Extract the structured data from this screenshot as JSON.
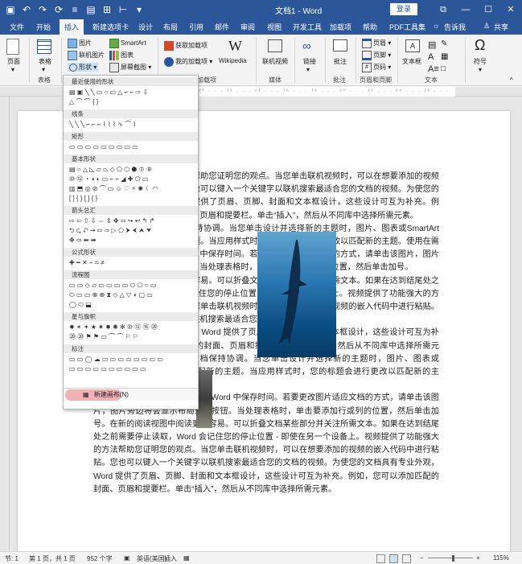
{
  "titlebar": {
    "title": "文档1 - Word",
    "login": "登录",
    "quick_access": [
      "save-icon",
      "undo-icon",
      "redo-icon",
      "repeat-icon",
      "menu-icon",
      "print-preview-icon",
      "layout-icon",
      "format-icon",
      "more-icon"
    ]
  },
  "tabs": [
    "文件",
    "开始",
    "插入",
    "新建选项卡",
    "设计",
    "布局",
    "引用",
    "邮件",
    "审阅",
    "视图",
    "开发工具",
    "加载项",
    "帮助",
    "PDF工具集",
    "告诉我",
    "共享"
  ],
  "ribbon": {
    "page": "页面",
    "table": "表格",
    "picture": "图片",
    "online_picture": "联机图片",
    "shapes": "形状",
    "smartart": "SmartArt",
    "chart": "图表",
    "screenshot": "屏幕截图",
    "get_addins": "获取加载项",
    "my_addins": "我的加载项",
    "wikipedia": "Wikipedia",
    "online_video": "联机视频",
    "link": "链接",
    "comment": "批注",
    "header": "页眉",
    "footer": "页脚",
    "page_number": "页码",
    "textbox": "文本框",
    "symbol": "符号",
    "groups": {
      "table": "表格",
      "addins": "加载项",
      "media": "媒体",
      "comment": "批注",
      "header_footer": "页眉和页脚",
      "text": "文本"
    }
  },
  "shapes_menu": {
    "sections": [
      "最近使用的形状",
      "线条",
      "矩形",
      "基本形状",
      "箭头总汇",
      "公式形状",
      "流程图",
      "星与旗帜",
      "标注"
    ],
    "new_canvas": "新建画布(N)"
  },
  "document": {
    "paragraphs": [
      "视频提供了功能强大的方法帮助您证明您的观点。当您单击联机视频时，可以在想要添加的视频的嵌入代码中进行粘贴。您也可以键入一个关键字以联机搜索最适合您的文档的视频。为使您的文档具有专业外观，Word 提供了页眉、页脚、封面和文本框设计，这些设计可互为补充。例如，您可以添加匹配的封面、页眉和提要栏。单击“插入”，然后从不同库中选择所需元素。",
      "主题和样式也有助于文档保持协调。当您单击设计并选择新的主题时，图片、图表或SmartArt 图形将会更改以匹配新的主题。当应用样式时，您的标题会进行更改以匹配新的主题。使用在需要位置出现的新按钮在 Word 中保存时间。若要更改图片适应文档的方式，请单击该图片，图片旁边将会显示布局选项按钮。当处理表格时，单击要添加行或列的位置，然后单击加号。",
      "在新的阅读视图中阅读更加容易。可以折叠文档某些部分并关注所需文本。如果在达到结尾处之前需要停止读取，Word 会记住您的停止位置 - 即使在另一个设备上。视频提供了功能强大的方法帮助您证明您的观点。当您单击联机视频时，可以在想要添加的视频的嵌入代码中进行粘贴。您也可以键入一个关键字以联机搜索最适合您的文档的视频。",
      "为使您的文档具有专业外观，Word 提供了页眉、页脚、封面和文本框设计，这些设计可互为补充。例如，您可以添加匹配的封面、页眉和提要栏。单击“插入”，然后从不同库中选择所需元素。主题和样式也有助于文档保持协调。当您单击设计并选择新的主题时，图片、图表或 SmartArt 图形将会更改以匹配新的主题。当应用样式时，您的标题会进行更改以匹配新的主题。",
      "使用在需要位置出现的新按钮在 Word 中保存时间。若要更改图片适应文档的方式，请单击该图片，图片旁边将会显示布局选项按钮。当处理表格时，单击要添加行或列的位置，然后单击加号。在新的阅读视图中阅读更加容易。可以折叠文档某些部分并关注所需文本。如果在达到结尾处之前需要停止读取，Word 会记住您的停止位置 - 即使在另一个设备上。视频提供了功能强大的方法帮助您证明您的观点。当您单击联机视频时，可以在想要添加的视频的嵌入代码中进行粘贴。您也可以键入一个关键字以联机搜索最适合您的文档的视频。为使您的文档具有专业外观，Word 提供了页眉、页脚、封面和文本框设计，这些设计可互为补充。例如，您可以添加匹配的封面、页眉和提要栏。单击“插入”，然后从不同库中选择所需元素。"
    ]
  },
  "statusbar": {
    "section": "节: 1",
    "page": "第 1 页，共 1 页",
    "words": "952 个字",
    "language": "英语(美国)",
    "mode": "插入",
    "zoom": "115%"
  },
  "colors": {
    "word_blue": "#2b579a",
    "highlight": "#e85a64"
  }
}
